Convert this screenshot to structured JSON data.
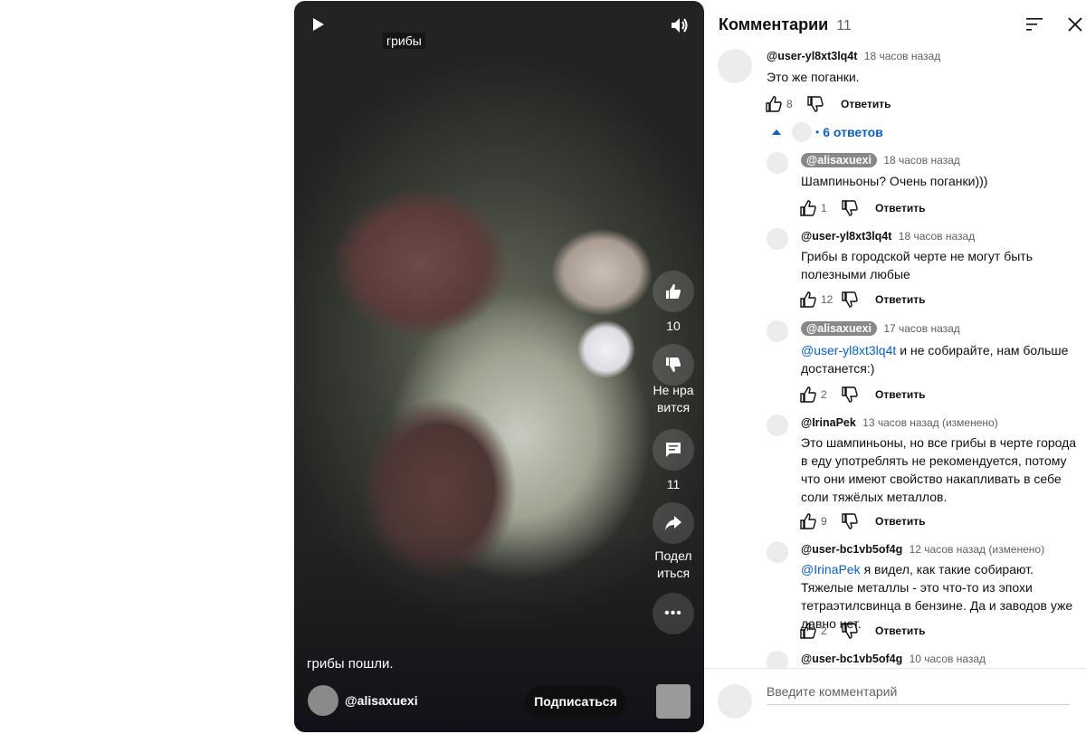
{
  "video": {
    "top_title": "грибы",
    "caption": "грибы пошли.",
    "author": "@alisaxuexi",
    "subscribe_label": "Подписаться",
    "likes": "10",
    "dislike_label": "Не нравится",
    "comments_count": "11",
    "share_label": "Поделиться"
  },
  "panel": {
    "title": "Комментарии",
    "count": "11",
    "composer_placeholder": "Введите комментарий"
  },
  "comments": [
    {
      "author": "@user-yl8xt3lq4t",
      "time": "18 часов назад",
      "text": "Это же поганки.",
      "likes": "8",
      "reply_label": "Ответить",
      "replies_label": "6 ответов"
    }
  ],
  "replies": [
    {
      "author": "@alisaxuexi",
      "time": "18 часов назад",
      "mention": "",
      "text": "Шампиньоны? Очень поганки)))",
      "likes": "1",
      "reply_label": "Ответить"
    },
    {
      "author": "@user-yl8xt3lq4t",
      "time": "18 часов назад",
      "mention": "",
      "text": "Грибы в городской черте не могут быть полезными любые",
      "likes": "12",
      "reply_label": "Ответить"
    },
    {
      "author": "@alisaxuexi",
      "time": "17 часов назад",
      "mention": "@user-yl8xt3lq4t",
      "text": "и не собирайте, нам больше достанется:)",
      "likes": "2",
      "reply_label": "Ответить"
    },
    {
      "author": "@IrinaPek",
      "time": "13 часов назад (изменено)",
      "mention": "",
      "text": "Это шампиньоны, но все грибы в черте города в еду употреблять не рекомендуется, потому что они имеют свойство накапливать в себе соли тяжёлых металлов.",
      "likes": "9",
      "reply_label": "Ответить"
    },
    {
      "author": "@user-bc1vb5of4g",
      "time": "12 часов назад (изменено)",
      "mention": "@IrinaPek",
      "text": "я видел, как такие собирают. Тяжелые металлы - это что-то из эпохи тетраэтилсвинца в бензине. Да и заводов уже давно нет.",
      "likes": "2",
      "reply_label": "Ответить"
    },
    {
      "author": "@user-bc1vb5of4g",
      "time": "10 часов назад",
      "mention": "",
      "text": "",
      "likes": "",
      "reply_label": ""
    }
  ]
}
